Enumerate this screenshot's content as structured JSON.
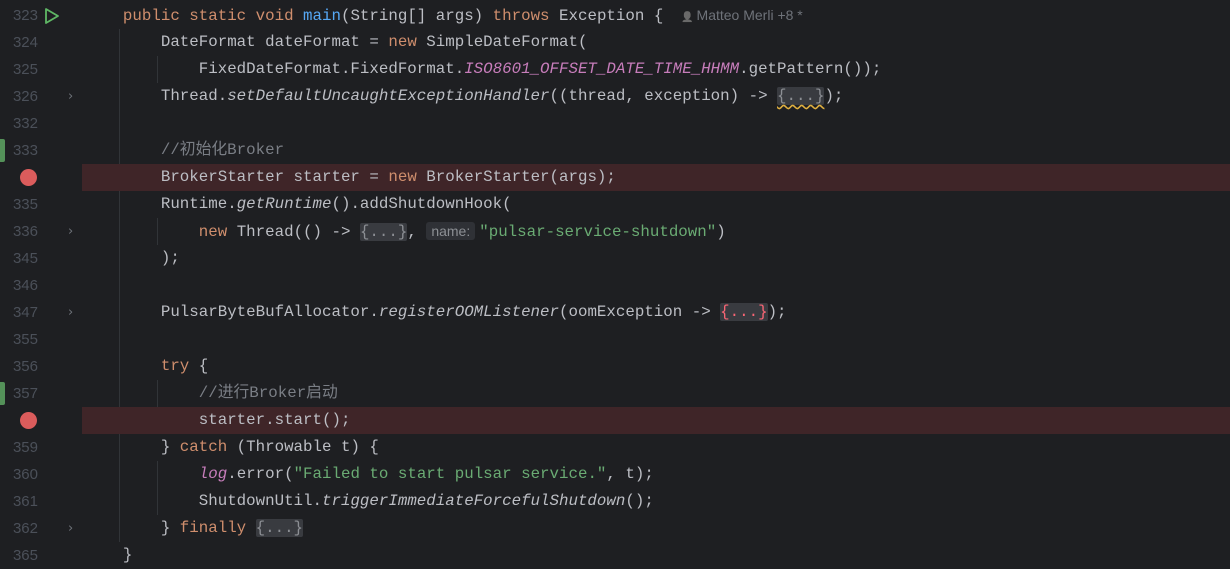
{
  "editor": {
    "author_hint": "Matteo Merli +8 *",
    "lines": [
      {
        "num": "323",
        "marker": "run",
        "tokens": [
          [
            "",
            "    "
          ],
          [
            "kw",
            "public static void "
          ],
          [
            "fn",
            "main"
          ],
          [
            "",
            "(String[] args) "
          ],
          [
            "kw",
            "throws"
          ],
          [
            "",
            " Exception {"
          ]
        ],
        "author": true
      },
      {
        "num": "324",
        "tokens": [
          [
            "",
            "        DateFormat dateFormat = "
          ],
          [
            "kw",
            "new"
          ],
          [
            "",
            " SimpleDateFormat("
          ]
        ]
      },
      {
        "num": "325",
        "tokens": [
          [
            "",
            "            FixedDateFormat.FixedFormat."
          ],
          [
            "const",
            "ISO8601_OFFSET_DATE_TIME_HHMM"
          ],
          [
            "",
            ".getPattern());"
          ]
        ]
      },
      {
        "num": "326",
        "fold": true,
        "tokens": [
          [
            "",
            "        Thread."
          ],
          [
            "it",
            "setDefaultUncaughtExceptionHandler"
          ],
          [
            "",
            "((thread, exception) -> "
          ],
          [
            "fold warn",
            "{...}"
          ],
          [
            "",
            ");"
          ]
        ]
      },
      {
        "num": "332",
        "tokens": []
      },
      {
        "num": "333",
        "marker": "changed",
        "tokens": [
          [
            "cm",
            "        //初始化Broker"
          ]
        ]
      },
      {
        "num": "",
        "marker": "breakpoint",
        "tokens": [
          [
            "",
            "        BrokerStarter starter = "
          ],
          [
            "kw",
            "new"
          ],
          [
            "",
            " BrokerStarter(args);"
          ]
        ]
      },
      {
        "num": "335",
        "tokens": [
          [
            "",
            "        Runtime."
          ],
          [
            "it",
            "getRuntime"
          ],
          [
            "",
            "().addShutdownHook("
          ]
        ]
      },
      {
        "num": "336",
        "fold": true,
        "tokens": [
          [
            "",
            "            "
          ],
          [
            "kw",
            "new"
          ],
          [
            "",
            " Thread(() -> "
          ],
          [
            "fold",
            "{...}"
          ],
          [
            "",
            ", "
          ],
          [
            "hint",
            "name:"
          ],
          [
            "str",
            "\"pulsar-service-shutdown\""
          ],
          [
            "",
            ")"
          ]
        ]
      },
      {
        "num": "345",
        "tokens": [
          [
            "",
            "        );"
          ]
        ]
      },
      {
        "num": "346",
        "tokens": []
      },
      {
        "num": "347",
        "fold": true,
        "tokens": [
          [
            "",
            "        PulsarByteBufAllocator."
          ],
          [
            "it",
            "registerOOMListener"
          ],
          [
            "",
            "(oomException -> "
          ],
          [
            "fold err",
            "{...}"
          ],
          [
            "",
            ");"
          ]
        ]
      },
      {
        "num": "355",
        "tokens": []
      },
      {
        "num": "356",
        "tokens": [
          [
            "",
            "        "
          ],
          [
            "kw",
            "try"
          ],
          [
            "",
            " {"
          ]
        ]
      },
      {
        "num": "357",
        "marker": "changed",
        "tokens": [
          [
            "cm",
            "            //进行Broker启动"
          ]
        ]
      },
      {
        "num": "",
        "marker": "breakpoint",
        "tokens": [
          [
            "",
            "            starter.start();"
          ]
        ]
      },
      {
        "num": "359",
        "tokens": [
          [
            "",
            "        } "
          ],
          [
            "kw",
            "catch"
          ],
          [
            "",
            " (Throwable t) {"
          ]
        ]
      },
      {
        "num": "360",
        "tokens": [
          [
            "",
            "            "
          ],
          [
            "const",
            "log"
          ],
          [
            "",
            ".error("
          ],
          [
            "str",
            "\"Failed to start pulsar service.\""
          ],
          [
            "",
            ", t);"
          ]
        ]
      },
      {
        "num": "361",
        "tokens": [
          [
            "",
            "            ShutdownUtil."
          ],
          [
            "it",
            "triggerImmediateForcefulShutdown"
          ],
          [
            "",
            "();"
          ]
        ]
      },
      {
        "num": "362",
        "fold": true,
        "tokens": [
          [
            "",
            "        } "
          ],
          [
            "kw",
            "finally"
          ],
          [
            "",
            " "
          ],
          [
            "fold",
            "{...}"
          ]
        ]
      },
      {
        "num": "365",
        "tokens": [
          [
            "",
            "    }"
          ]
        ]
      }
    ]
  }
}
